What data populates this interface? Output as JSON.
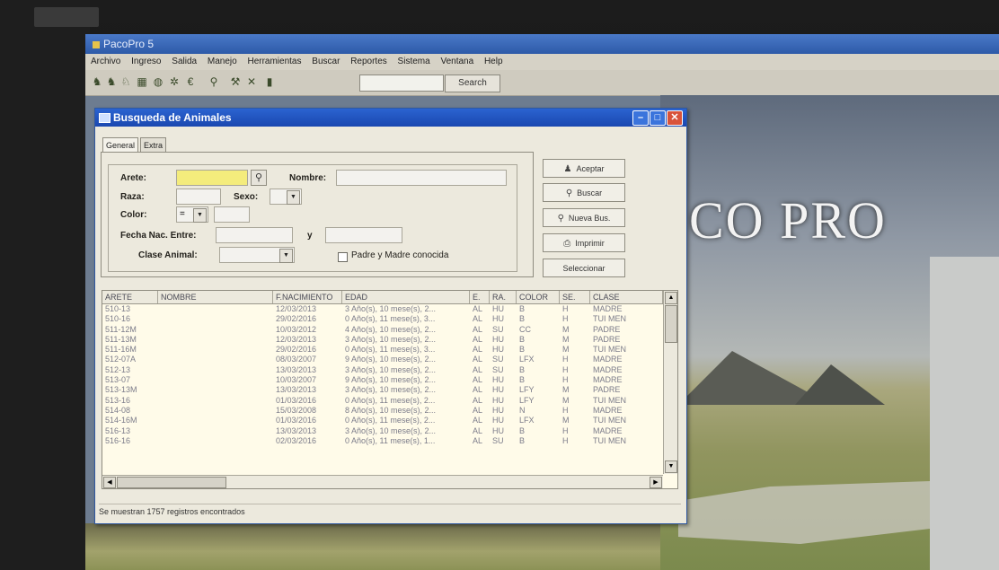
{
  "app": {
    "title": "PacoPro 5",
    "menu": [
      "Archivo",
      "Ingreso",
      "Salida",
      "Manejo",
      "Herramientas",
      "Buscar",
      "Reportes",
      "Sistema",
      "Ventana",
      "Help"
    ],
    "search_label": "Search",
    "splash_title": "CO PRO"
  },
  "dialog": {
    "title": "Busqueda de Animales",
    "tabs": [
      "General",
      "Extra"
    ],
    "fields": {
      "arete_label": "Arete:",
      "nombre_label": "Nombre:",
      "raza_label": "Raza:",
      "sexo_label": "Sexo:",
      "color_label": "Color:",
      "color_op": "=",
      "fecha_label": "Fecha Nac. Entre:",
      "fecha_and": "y",
      "clase_label": "Clase Animal:",
      "padre_madre_label": "Padre y Madre conocida"
    },
    "buttons": {
      "aceptar": "Aceptar",
      "buscar": "Buscar",
      "nueva": "Nueva Bus.",
      "imprimir": "Imprimir",
      "seleccionar": "Seleccionar"
    },
    "grid": {
      "headers": [
        "ARETE",
        "NOMBRE",
        "F.NACIMIENTO",
        "EDAD",
        "E.",
        "RA.",
        "COLOR",
        "SE.",
        "CLASE"
      ],
      "rows": [
        [
          "510-13",
          "",
          "12/03/2013",
          "3 Año(s), 10 mese(s), 2...",
          "AL",
          "HU",
          "B",
          "H",
          "MADRE"
        ],
        [
          "510-16",
          "",
          "29/02/2016",
          "0 Año(s), 11 mese(s), 3...",
          "AL",
          "HU",
          "B",
          "H",
          "TUI MEN"
        ],
        [
          "511-12M",
          "",
          "10/03/2012",
          "4 Año(s), 10 mese(s), 2...",
          "AL",
          "SU",
          "CC",
          "M",
          "PADRE"
        ],
        [
          "511-13M",
          "",
          "12/03/2013",
          "3 Año(s), 10 mese(s), 2...",
          "AL",
          "HU",
          "B",
          "M",
          "PADRE"
        ],
        [
          "511-16M",
          "",
          "29/02/2016",
          "0 Año(s), 11 mese(s), 3...",
          "AL",
          "HU",
          "B",
          "M",
          "TUI MEN"
        ],
        [
          "512-07A",
          "",
          "08/03/2007",
          "9 Año(s), 10 mese(s), 2...",
          "AL",
          "SU",
          "LFX",
          "H",
          "MADRE"
        ],
        [
          "512-13",
          "",
          "13/03/2013",
          "3 Año(s), 10 mese(s), 2...",
          "AL",
          "SU",
          "B",
          "H",
          "MADRE"
        ],
        [
          "513-07",
          "",
          "10/03/2007",
          "9 Año(s), 10 mese(s), 2...",
          "AL",
          "HU",
          "B",
          "H",
          "MADRE"
        ],
        [
          "513-13M",
          "",
          "13/03/2013",
          "3 Año(s), 10 mese(s), 2...",
          "AL",
          "HU",
          "LFY",
          "M",
          "PADRE"
        ],
        [
          "513-16",
          "",
          "01/03/2016",
          "0 Año(s), 11 mese(s), 2...",
          "AL",
          "HU",
          "LFY",
          "M",
          "TUI MEN"
        ],
        [
          "514-08",
          "",
          "15/03/2008",
          "8 Año(s), 10 mese(s), 2...",
          "AL",
          "HU",
          "N",
          "H",
          "MADRE"
        ],
        [
          "514-16M",
          "",
          "01/03/2016",
          "0 Año(s), 11 mese(s), 2...",
          "AL",
          "HU",
          "LFX",
          "M",
          "TUI MEN"
        ],
        [
          "516-13",
          "",
          "13/03/2013",
          "3 Año(s), 10 mese(s), 2...",
          "AL",
          "HU",
          "B",
          "H",
          "MADRE"
        ],
        [
          "516-16",
          "",
          "02/03/2016",
          "0 Año(s), 11 mese(s), 1...",
          "AL",
          "SU",
          "B",
          "H",
          "TUI MEN"
        ]
      ]
    },
    "status": "Se muestran 1757 registros encontrados"
  },
  "colors": {
    "arete_field": "#f4ec7c",
    "titlebar": "#2b63d0",
    "close_button": "#d8533b"
  }
}
